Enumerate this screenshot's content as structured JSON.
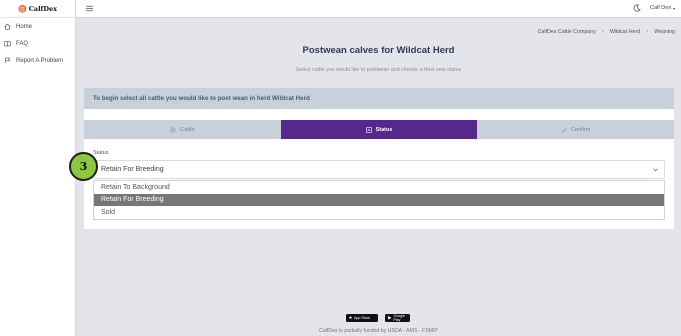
{
  "app": {
    "logo_text": "CalfDex"
  },
  "sidebar": {
    "items": [
      {
        "label": "Home",
        "icon": "home-icon"
      },
      {
        "label": "FAQ",
        "icon": "book-icon"
      },
      {
        "label": "Report A Problem",
        "icon": "report-icon"
      }
    ]
  },
  "topbar": {
    "user_label": "Calf Dex"
  },
  "breadcrumb": [
    "CalfDex Cattle Company",
    "Wildcat Herd",
    "Weaning"
  ],
  "page": {
    "title": "Postwean calves for Wildcat Herd",
    "subtitle": "Select cattle you would like to postwean and choose a their new status"
  },
  "card": {
    "header": "To begin select all cattle you would like to post wean in herd Wildcat Herd",
    "steps": [
      {
        "label": "Cattle",
        "icon": "cow-icon",
        "active": false
      },
      {
        "label": "Status",
        "icon": "status-icon",
        "active": true
      },
      {
        "label": "Confirm",
        "icon": "check-icon",
        "active": false
      }
    ],
    "status_label": "Status",
    "status_value": "Retain For Breeding",
    "annotation_number": "3",
    "options": [
      {
        "label": "Retain To Background",
        "selected": false
      },
      {
        "label": "Retain For Breeding",
        "selected": true
      },
      {
        "label": "Sold",
        "selected": false
      }
    ]
  },
  "footer": {
    "app_store": "App Store",
    "google_play": "Google Play",
    "text": "CalfDex is partially funded by USDA - AMS - FSMIP"
  },
  "colors": {
    "accent": "#57288b",
    "step_inactive": "#c8d0da",
    "selected_option": "#767676",
    "badge": "#8dc63f"
  }
}
